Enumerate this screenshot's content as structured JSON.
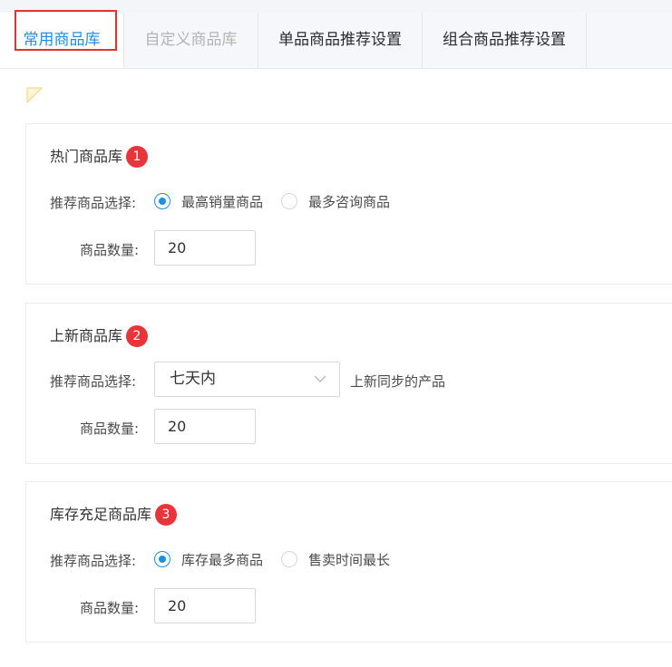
{
  "tabs": [
    {
      "label": "常用商品库",
      "state": "active"
    },
    {
      "label": "自定义商品库",
      "state": "disabled"
    },
    {
      "label": "单品商品推荐设置",
      "state": "normal"
    },
    {
      "label": "组合商品推荐设置",
      "state": "normal"
    }
  ],
  "colors": {
    "accent": "#1e8fe1",
    "badge": "#e8353a",
    "highlight_outline": "#e5322d"
  },
  "hot": {
    "title": "热门商品库",
    "badge": "1",
    "select_label": "推荐商品选择",
    "options": [
      "最高销量商品",
      "最多咨询商品"
    ],
    "selected_index": 0,
    "count_label": "商品数量",
    "count_value": "20"
  },
  "new": {
    "title": "上新商品库",
    "badge": "2",
    "select_label": "推荐商品选择",
    "dropdown_value": "七天内",
    "dropdown_note": "上新同步的产品",
    "count_label": "商品数量",
    "count_value": "20"
  },
  "stock": {
    "title": "库存充足商品库",
    "badge": "3",
    "select_label": "推荐商品选择",
    "options": [
      "库存最多商品",
      "售卖时间最长"
    ],
    "selected_index": 0,
    "count_label": "商品数量",
    "count_value": "20"
  },
  "label_suffix": ":"
}
